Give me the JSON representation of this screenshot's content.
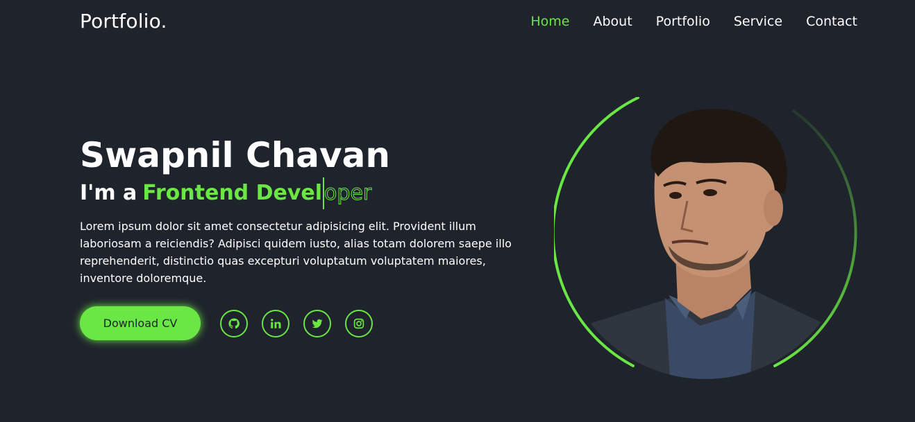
{
  "header": {
    "logo": "Portfolio.",
    "nav": [
      {
        "label": "Home",
        "active": true
      },
      {
        "label": "About"
      },
      {
        "label": "Portfolio"
      },
      {
        "label": "Service"
      },
      {
        "label": "Contact"
      }
    ]
  },
  "hero": {
    "name": "Swapnil Chavan",
    "role_prefix": "I'm a",
    "role_filled": "Frontend Devel",
    "role_outline": "oper",
    "description": "Lorem ipsum dolor sit amet consectetur adipisicing elit. Provident illum laboriosam a reiciendis? Adipisci quidem iusto, alias totam dolorem saepe illo reprehenderit, distinctio quas excepturi voluptatum voluptatem maiores, inventore doloremque.",
    "cta_label": "Download CV",
    "socials": [
      "github-icon",
      "linkedin-icon",
      "twitter-icon",
      "instagram-icon"
    ]
  },
  "colors": {
    "background": "#1f232c",
    "accent": "#6ae744",
    "text": "#ffffff"
  }
}
